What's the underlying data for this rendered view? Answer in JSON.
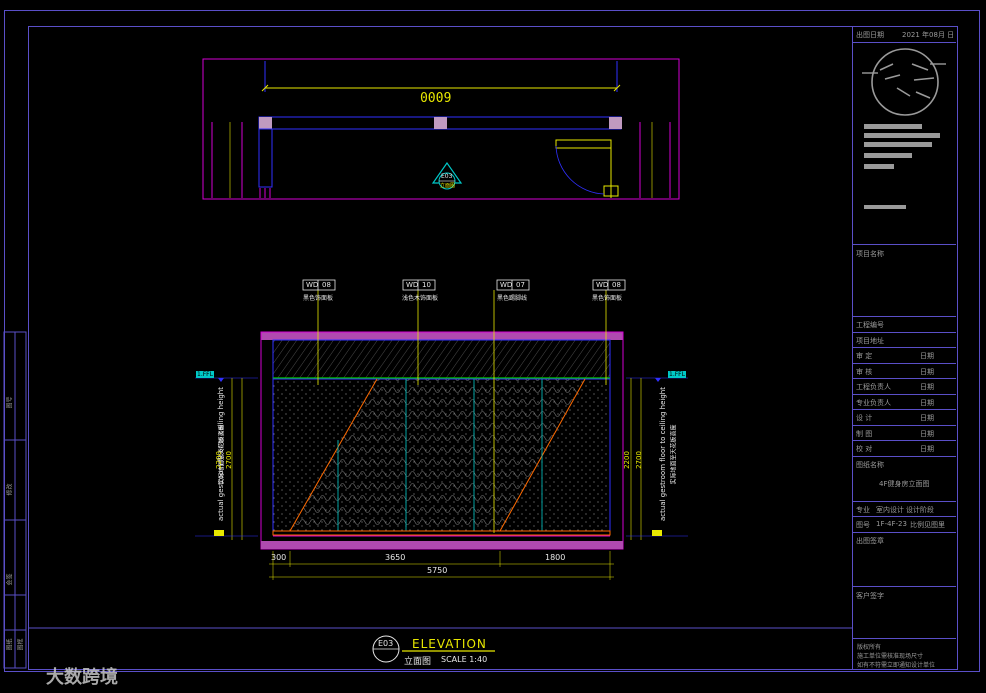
{
  "plan": {
    "overall_dim": "6000",
    "section_tag": "E03",
    "section_sub": "立面图"
  },
  "elevation": {
    "tags": [
      {
        "code": "WD",
        "num": "08",
        "desc": "黑色饰面板"
      },
      {
        "code": "WD",
        "num": "10",
        "desc": "浅色木饰面板"
      },
      {
        "code": "WD",
        "num": "07",
        "desc": "黑色踢脚线"
      },
      {
        "code": "WD",
        "num": "08",
        "desc": "黑色饰面板"
      }
    ],
    "left_level": "1.FFL",
    "right_level": "1.FFL",
    "left_note_cn": "实际地面至天花板高度",
    "left_note_en": "actual gestroom floor to ceiling height",
    "right_note_cn": "实际地面至天花板高度",
    "right_note_en": "actual gestroom floor to ceiling height",
    "left_dims": [
      "2200",
      "2700"
    ],
    "right_dims": [
      "2200",
      "2700"
    ],
    "bottom_dims": [
      "300",
      "3650",
      "1800"
    ],
    "total_dim": "5750"
  },
  "title_block_main": {
    "tag": "E03",
    "title": "ELEVATION",
    "subtitle": "立面图",
    "scale": "SCALE 1:40"
  },
  "right_block": {
    "date_label": "出图日期",
    "date_value": "2021 年08月  日",
    "project_name_label": "项目名称",
    "rows": [
      {
        "label": "工程编号",
        "right": ""
      },
      {
        "label": "项目地址",
        "right": ""
      },
      {
        "label": "审  定",
        "right": "日期"
      },
      {
        "label": "审  核",
        "right": "日期"
      },
      {
        "label": "工程负责人",
        "right": "日期"
      },
      {
        "label": "专业负责人",
        "right": "日期"
      },
      {
        "label": "设  计",
        "right": "日期"
      },
      {
        "label": "制  图",
        "right": "日期"
      },
      {
        "label": "校  对",
        "right": "日期"
      }
    ],
    "drawing_name_label": "图纸名称",
    "drawing_name": "4F健身房立面图",
    "spec_row": [
      "专业",
      "室内设计",
      "设计阶段"
    ],
    "no_row": [
      "图号",
      "1F-4F-23",
      "比例见图里"
    ],
    "stamp_label": "出图签章",
    "client_label": "客户签字",
    "copyright": [
      "版权所有",
      "施工单位需核准现场尺寸",
      "如有不符需立即通知设计单位"
    ]
  },
  "left_strip": [
    "图号",
    "修改",
    "会签",
    "图纸",
    "图框"
  ],
  "watermark": "大数跨境",
  "colors": {
    "frame": "#5a4fc8",
    "magenta": "#d400d4",
    "yellow": "#e8e800",
    "cyan": "#00c8c8",
    "green": "#00d400",
    "orange": "#ff6a00",
    "blue": "#3030ff",
    "white": "#e8e8e8"
  }
}
